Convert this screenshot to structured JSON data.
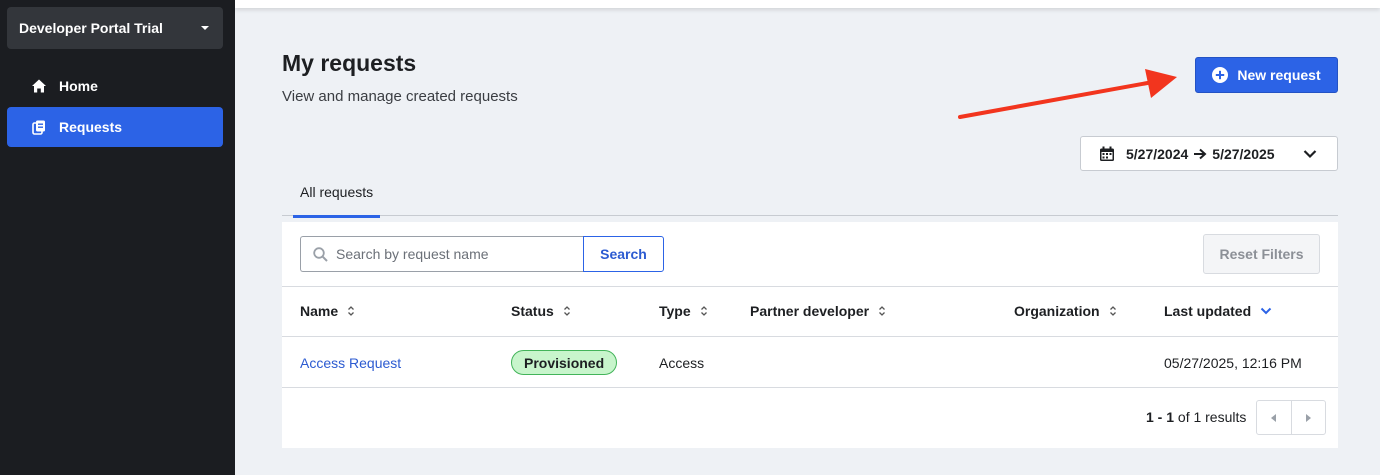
{
  "sidebar": {
    "org_name": "Developer Portal Trial",
    "items": [
      {
        "label": "Home",
        "icon": "home-icon"
      },
      {
        "label": "Requests",
        "icon": "requests-icon",
        "active": true
      }
    ]
  },
  "header": {
    "title": "My requests",
    "subtitle": "View and manage created requests",
    "new_request_label": "New request"
  },
  "date_range": {
    "start": "5/27/2024",
    "end": "5/27/2025"
  },
  "tabs": [
    {
      "label": "All requests",
      "active": true
    }
  ],
  "search": {
    "placeholder": "Search by request name",
    "value": "",
    "button_label": "Search"
  },
  "reset_filters_label": "Reset Filters",
  "table": {
    "columns": [
      "Name",
      "Status",
      "Type",
      "Partner developer",
      "Organization",
      "Last updated"
    ],
    "rows": [
      {
        "name": "Access Request",
        "status": "Provisioned",
        "type": "Access",
        "partner_developer": "",
        "organization": "",
        "last_updated": "05/27/2025, 12:16 PM"
      }
    ]
  },
  "pagination": {
    "range": "1 - 1",
    "of_text": "of 1 results"
  },
  "colors": {
    "accent": "#2c63e6",
    "sidebar_bg": "#1b1d21",
    "badge_bg": "#c8f5cc",
    "annotation_arrow": "#f2351e"
  }
}
